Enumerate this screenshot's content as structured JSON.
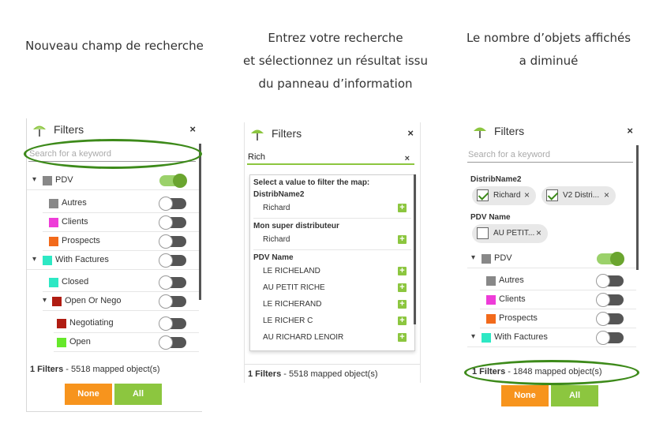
{
  "captions": {
    "c1": "Nouveau champ de recherche",
    "c2_line1": "Entrez votre recherche",
    "c2_line2": "et sélectionnez un résultat issu",
    "c2_line3": "du panneau d’information",
    "c3_line1": "Le nombre d’objets affichés",
    "c3_line2": "a diminué"
  },
  "panel1": {
    "title": "Filters",
    "close": "×",
    "search_placeholder": "Search for a keyword",
    "rows": {
      "pdv": "PDV",
      "autres": "Autres",
      "clients": "Clients",
      "prospects": "Prospects",
      "with_factures": "With Factures",
      "closed": "Closed",
      "open_or_nego": "Open Or Nego",
      "negotiating": "Negotiating",
      "open": "Open"
    },
    "footer_bold": "1 Filters",
    "footer_rest": " - 5518 mapped object(s)",
    "btn_none": "None",
    "btn_all": "All"
  },
  "panel2": {
    "title": "Filters",
    "close": "×",
    "search_value": "Rich",
    "search_clear": "×",
    "dropdown": {
      "heading": "Select a value to filter the map:",
      "group1": "DistribName2",
      "group1_items": [
        "Richard"
      ],
      "group2": "Mon super distributeur",
      "group2_items": [
        "Richard"
      ],
      "group3": "PDV Name",
      "group3_items": [
        "LE RICHELAND",
        "AU PETIT RICHE",
        "LE RICHERAND",
        "LE RICHER C",
        "AU RICHARD LENOIR"
      ],
      "plus": "+"
    },
    "footer_bold": "1 Filters",
    "footer_rest": " - 5518 mapped object(s)"
  },
  "panel3": {
    "title": "Filters",
    "close": "×",
    "search_placeholder": "Search for a keyword",
    "group1": "DistribName2",
    "chips1": [
      "Richard",
      "V2 Distri..."
    ],
    "group2": "PDV Name",
    "chips2": [
      "AU PETIT..."
    ],
    "chip_close": "×",
    "rows": {
      "pdv": "PDV",
      "autres": "Autres",
      "clients": "Clients",
      "prospects": "Prospects",
      "with_factures": "With Factures"
    },
    "footer_bold": "1 Filters",
    "footer_rest": " - 1848 mapped object(s)",
    "btn_none": "None",
    "btn_all": "All"
  },
  "colors": {
    "accent_green": "#8cc63f",
    "orange": "#f7941d",
    "highlight_ellipse": "#3d8a1a",
    "gray": "#888888",
    "magenta": "#ee3cd8",
    "prospect_orange": "#f26a1b",
    "cyan": "#2de8c4",
    "dark_red": "#b01c12",
    "lime": "#66e82a"
  }
}
